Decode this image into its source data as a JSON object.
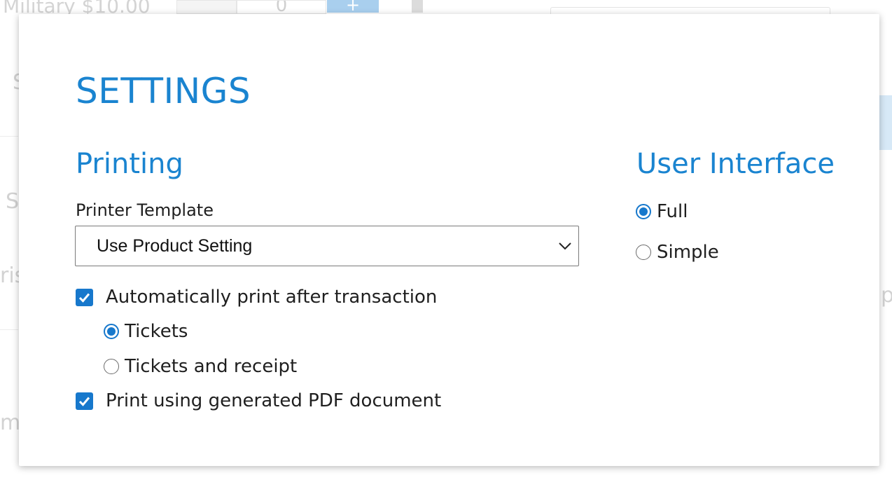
{
  "background": {
    "item_label": "Military $10.00",
    "quantity": "0",
    "plus_symbol": "+",
    "fragments": [
      "S",
      "S",
      "ris",
      "m",
      "p"
    ]
  },
  "modal": {
    "title": "SETTINGS",
    "printing": {
      "title": "Printing",
      "printer_template_label": "Printer Template",
      "printer_template_value": "Use Product Setting",
      "auto_print": {
        "label": "Automatically print after transaction",
        "checked": true
      },
      "print_options": [
        {
          "label": "Tickets",
          "selected": true
        },
        {
          "label": "Tickets and receipt",
          "selected": false
        }
      ],
      "pdf_print": {
        "label": "Print using generated PDF document",
        "checked": true
      }
    },
    "user_interface": {
      "title": "User Interface",
      "options": [
        {
          "label": "Full",
          "selected": true
        },
        {
          "label": "Simple",
          "selected": false
        }
      ]
    }
  },
  "icons": {
    "select_chevron": "chevron-down-icon",
    "checkmark": "checkmark-icon"
  },
  "colors": {
    "accent": "#1a84d0",
    "control_blue": "#1778cc",
    "text": "#1f1f1f",
    "border": "#7a7a7a"
  }
}
